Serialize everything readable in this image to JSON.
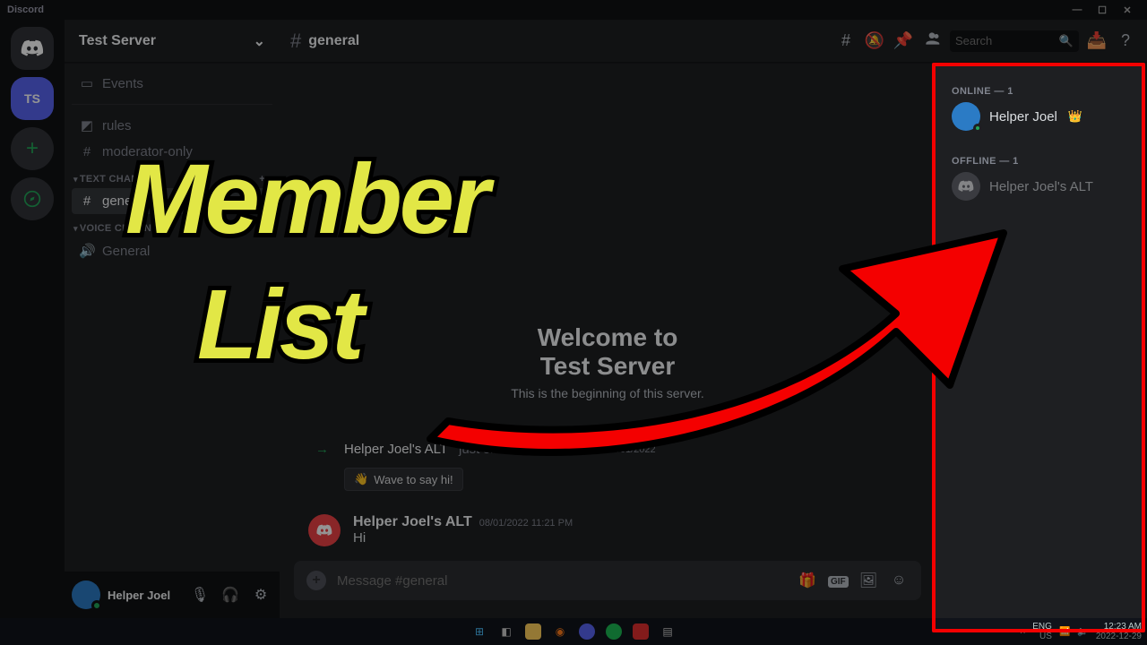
{
  "app_title": "Discord",
  "window_controls": {
    "min": "—",
    "max": "☐",
    "close": "✕"
  },
  "guilds": {
    "active_label": "TS"
  },
  "server": {
    "name": "Test Server",
    "events_label": "Events",
    "channels_rules": "rules",
    "channels_mod": "moderator-only",
    "cat_text": "TEXT CHANNELS",
    "channel_general": "general",
    "cat_voice": "VOICE CHANNELS",
    "voice_general": "General"
  },
  "user_panel": {
    "name": "Helper Joel"
  },
  "header": {
    "channel": "general",
    "search_placeholder": "Search"
  },
  "welcome": {
    "title_l1": "Welcome to",
    "title_l2": "Test Server",
    "subtitle": "This is the beginning of this server."
  },
  "join_event": {
    "user": "Helper Joel's ALT",
    "text": "just slid into the server.",
    "ts": "08/01/2022",
    "wave_label": "Wave to say hi!"
  },
  "message": {
    "author": "Helper Joel's ALT",
    "ts": "08/01/2022 11:21 PM",
    "text": "Hi"
  },
  "composer": {
    "placeholder": "Message #general"
  },
  "members": {
    "online_header": "ONLINE — 1",
    "online": [
      {
        "name": "Helper Joel",
        "owner": true
      }
    ],
    "offline_header": "OFFLINE — 1",
    "offline": [
      {
        "name": "Helper Joel's ALT"
      }
    ]
  },
  "taskbar": {
    "lang": "ENG",
    "region": "US",
    "time": "12:23 AM",
    "date": "2022-12-29"
  },
  "annotation": {
    "line1": "Member",
    "line2": "List"
  }
}
